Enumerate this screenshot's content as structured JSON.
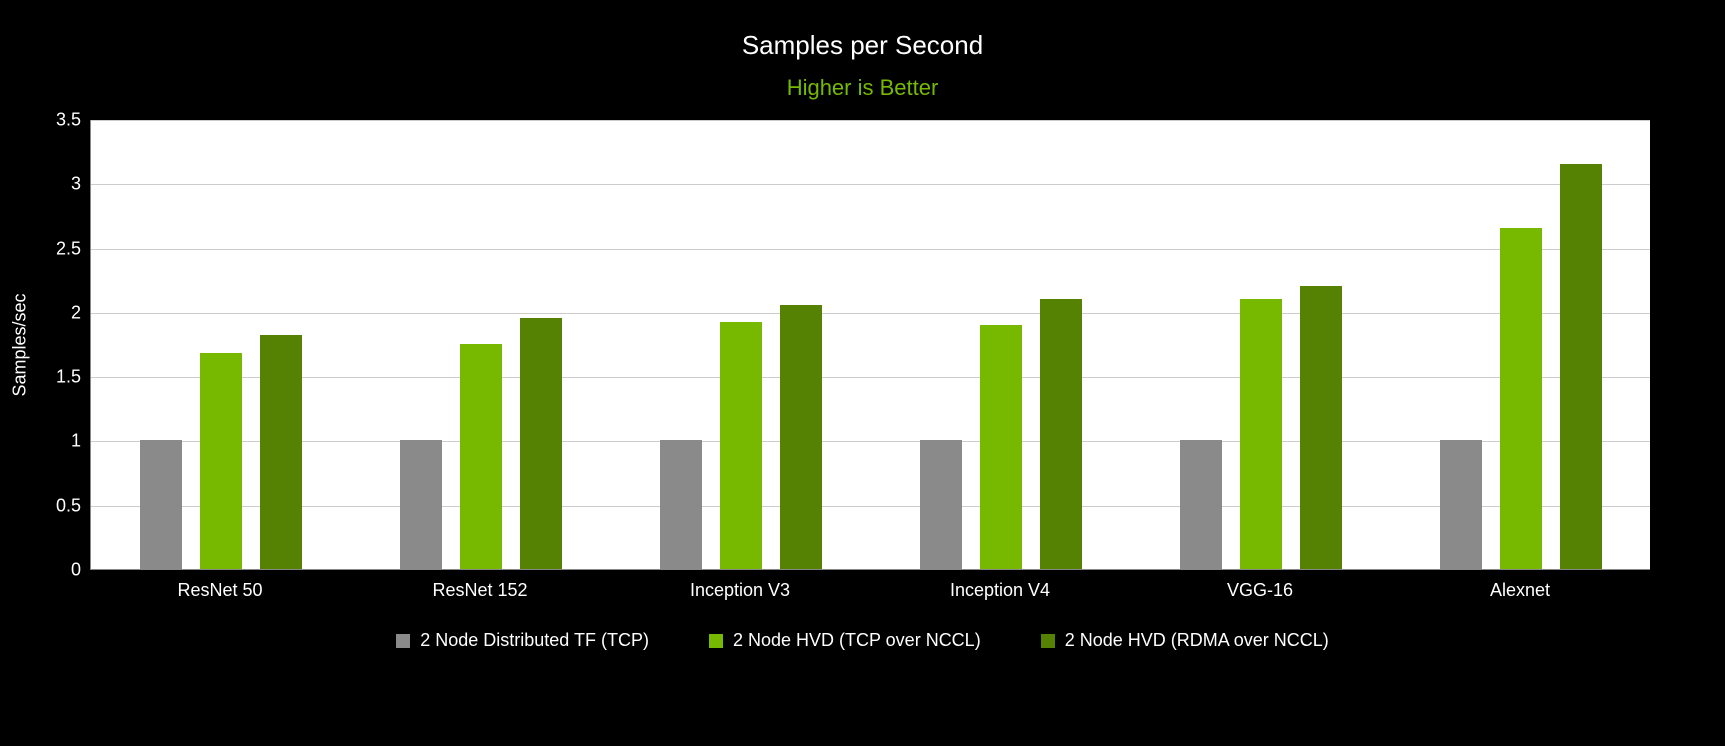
{
  "chart_data": {
    "type": "bar",
    "title": "Samples per Second",
    "subtitle": "Higher is Better",
    "ylabel": "Samples/sec",
    "ylim": [
      0,
      3.5
    ],
    "yticks": [
      0,
      0.5,
      1,
      1.5,
      2,
      2.5,
      3,
      3.5
    ],
    "categories": [
      "ResNet 50",
      "ResNet 152",
      "Inception V3",
      "Inception V4",
      "VGG-16",
      "Alexnet"
    ],
    "series": [
      {
        "name": "2 Node Distributed TF (TCP)",
        "color": "#8a8a8a",
        "values": [
          1.0,
          1.0,
          1.0,
          1.0,
          1.0,
          1.0
        ]
      },
      {
        "name": "2 Node HVD (TCP over NCCL)",
        "color": "#76b900",
        "values": [
          1.68,
          1.75,
          1.92,
          1.9,
          2.1,
          2.65
        ]
      },
      {
        "name": "2 Node HVD (RDMA over NCCL)",
        "color": "#568203",
        "values": [
          1.82,
          1.95,
          2.05,
          2.1,
          2.2,
          3.15
        ]
      }
    ]
  },
  "legend_labels": {
    "s0": "2 Node Distributed TF (TCP)",
    "s1": "2 Node HVD (TCP over NCCL)",
    "s2": "2 Node HVD (RDMA over NCCL)"
  }
}
